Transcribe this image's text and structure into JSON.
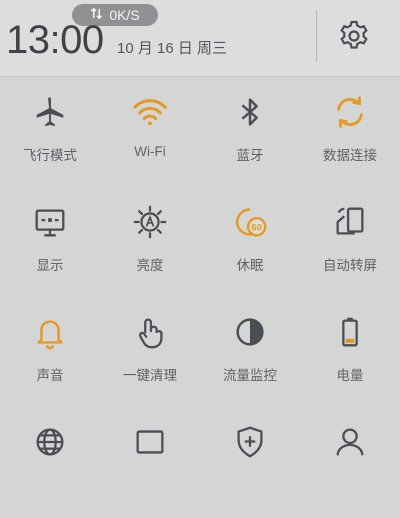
{
  "status": {
    "network_speed": "0K/S",
    "time": "13:00",
    "date": "10 月 16 日 周三"
  },
  "colors": {
    "active": "#e39b26",
    "inactive": "#4b4e52",
    "background": "#d4d6d6"
  },
  "tiles": [
    {
      "label": "飞行模式",
      "icon": "airplane-icon",
      "active": false
    },
    {
      "label": "Wi-Fi",
      "icon": "wifi-icon",
      "active": true
    },
    {
      "label": "蓝牙",
      "icon": "bluetooth-icon",
      "active": false
    },
    {
      "label": "数据连接",
      "icon": "data-sync-icon",
      "active": true
    },
    {
      "label": "显示",
      "icon": "display-icon",
      "active": false
    },
    {
      "label": "亮度",
      "icon": "brightness-auto-icon",
      "active": false
    },
    {
      "label": "休眠",
      "icon": "sleep-timer-icon",
      "active": true,
      "badge": "60"
    },
    {
      "label": "自动转屏",
      "icon": "rotate-screen-icon",
      "active": false
    },
    {
      "label": "声音",
      "icon": "bell-icon",
      "active": true
    },
    {
      "label": "一键清理",
      "icon": "tap-clean-icon",
      "active": false
    },
    {
      "label": "流量监控",
      "icon": "traffic-monitor-icon",
      "active": false
    },
    {
      "label": "电量",
      "icon": "battery-icon",
      "active": false
    },
    {
      "label": "",
      "icon": "globe-icon",
      "active": false
    },
    {
      "label": "",
      "icon": "screen-icon",
      "active": false
    },
    {
      "label": "",
      "icon": "shield-plus-icon",
      "active": false
    },
    {
      "label": "",
      "icon": "person-icon",
      "active": false
    }
  ]
}
